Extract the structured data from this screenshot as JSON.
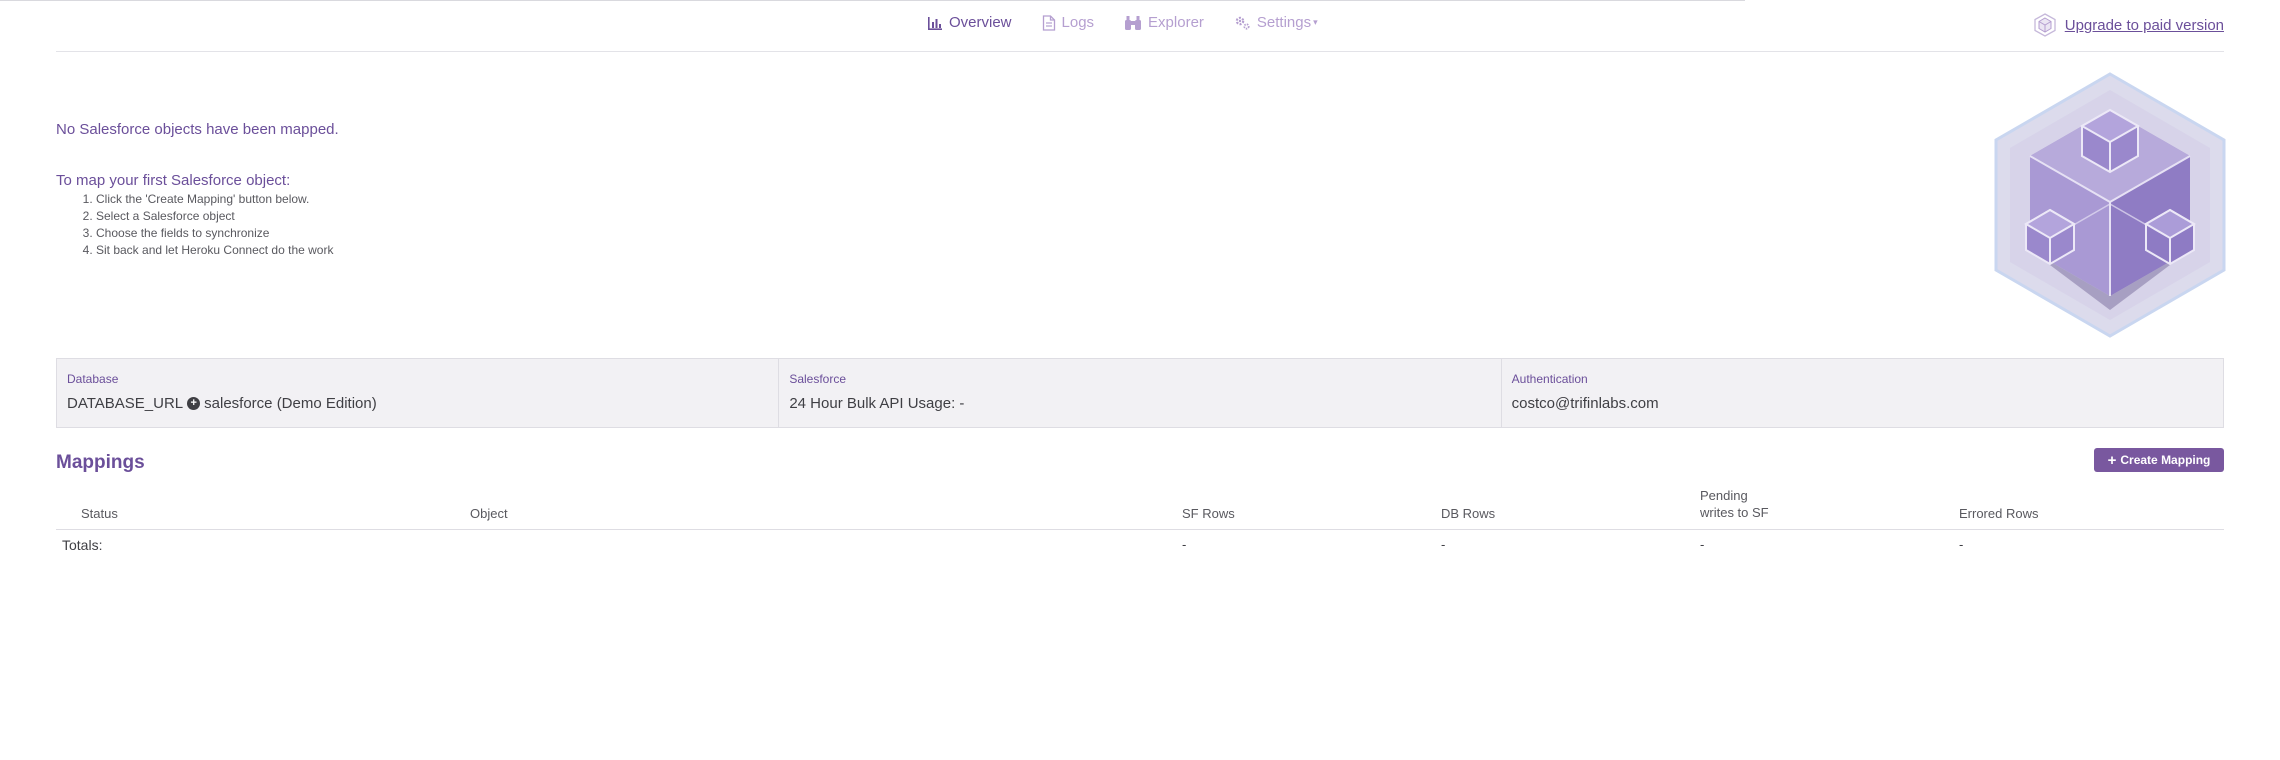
{
  "nav": {
    "items": [
      {
        "label": "Overview",
        "icon": "bar-chart-icon",
        "active": true
      },
      {
        "label": "Logs",
        "icon": "document-icon",
        "active": false
      },
      {
        "label": "Explorer",
        "icon": "binoculars-icon",
        "active": false
      },
      {
        "label": "Settings",
        "icon": "gear-icon",
        "active": false
      }
    ],
    "upgrade_label": "Upgrade to paid version"
  },
  "empty_state": {
    "message": "No Salesforce objects have been mapped.",
    "howto_title": "To map your first Salesforce object:",
    "steps": [
      "Click the 'Create Mapping' button below.",
      "Select a Salesforce object",
      "Choose the fields to synchronize",
      "Sit back and let Heroku Connect do the work"
    ]
  },
  "info": {
    "database": {
      "label": "Database",
      "var": "DATABASE_URL",
      "name": "salesforce (Demo Edition)"
    },
    "salesforce": {
      "label": "Salesforce",
      "value": "24 Hour Bulk API Usage: -"
    },
    "authentication": {
      "label": "Authentication",
      "value": "costco@trifinlabs.com"
    }
  },
  "mappings": {
    "title": "Mappings",
    "create_label": "Create Mapping",
    "columns": {
      "status": "Status",
      "object": "Object",
      "sf_rows": "SF Rows",
      "db_rows": "DB Rows",
      "pending_line1": "Pending",
      "pending_line2": "writes to SF",
      "errored": "Errored Rows"
    },
    "totals": {
      "label": "Totals:",
      "sf_rows": "-",
      "db_rows": "-",
      "pending": "-",
      "errored": "-"
    }
  },
  "colors": {
    "accent": "#6b4f9a",
    "muted_accent": "#b59fd0",
    "button": "#79589f",
    "panel_bg": "#f2f1f4"
  }
}
